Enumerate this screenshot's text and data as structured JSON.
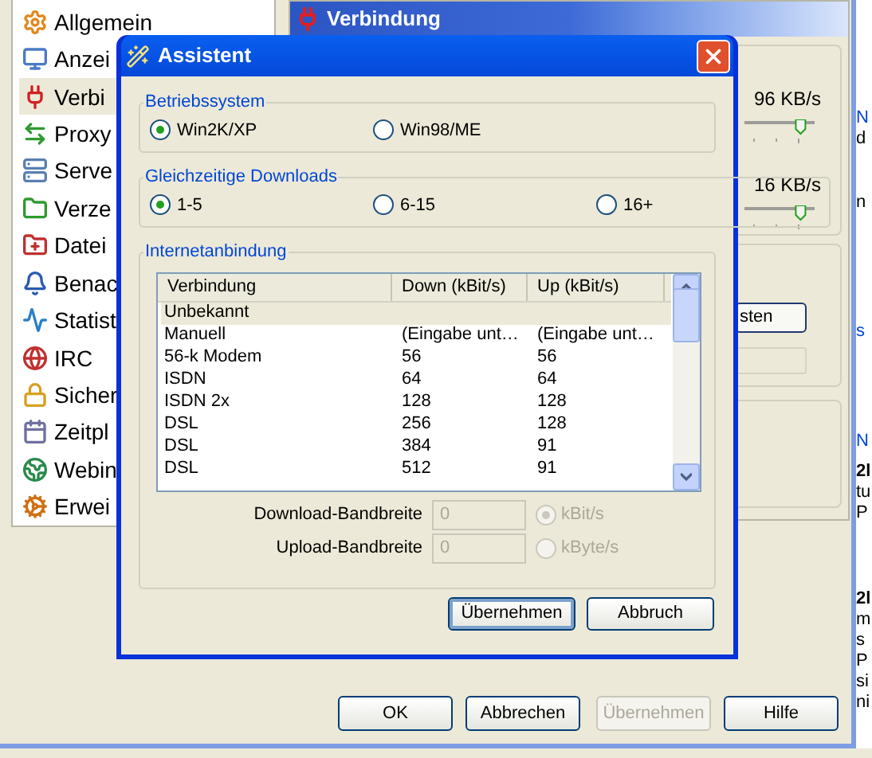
{
  "settings_window": {
    "categories": [
      {
        "label": "Allgemein",
        "selected": false
      },
      {
        "label": "Anzei",
        "selected": false
      },
      {
        "label": "Verbi",
        "selected": true
      },
      {
        "label": "Proxy",
        "selected": false
      },
      {
        "label": "Serve",
        "selected": false
      },
      {
        "label": "Verze",
        "selected": false
      },
      {
        "label": "Datei",
        "selected": false
      },
      {
        "label": "Benac",
        "selected": false
      },
      {
        "label": "Statist",
        "selected": false
      },
      {
        "label": "IRC",
        "selected": false
      },
      {
        "label": "Sicher",
        "selected": false
      },
      {
        "label": "Zeitpl",
        "selected": false
      },
      {
        "label": "Webin",
        "selected": false
      },
      {
        "label": "Erwei",
        "selected": false
      }
    ],
    "panel_title": "Verbindung",
    "speed_readings": [
      "96 KB/s",
      "16 KB/s"
    ],
    "sliders": [
      {
        "level": 0.8
      },
      {
        "level": 0.8
      }
    ],
    "partial_button": "sten",
    "buttons": [
      {
        "label": "OK",
        "disabled": false
      },
      {
        "label": "Abbrechen",
        "disabled": false
      },
      {
        "label": "Übernehmen",
        "disabled": true
      },
      {
        "label": "Hilfe",
        "disabled": false
      }
    ]
  },
  "assistant_dialog": {
    "title": "Assistent",
    "os_group": {
      "legend": "Betriebssystem",
      "options": [
        {
          "label": "Win2K/XP",
          "selected": true
        },
        {
          "label": "Win98/ME",
          "selected": false
        }
      ]
    },
    "downloads_group": {
      "legend": "Gleichzeitige Downloads",
      "options": [
        {
          "label": "1-5",
          "selected": true
        },
        {
          "label": "6-15",
          "selected": false
        },
        {
          "label": "16+",
          "selected": false
        }
      ]
    },
    "connection_group": {
      "legend": "Internetanbindung",
      "columns": [
        "Verbindung",
        "Down (kBit/s)",
        "Up (kBit/s)"
      ],
      "rows": [
        {
          "cells": [
            "Unbekannt",
            "",
            ""
          ],
          "selected": true
        },
        {
          "cells": [
            "Manuell",
            "(Eingabe unt…",
            "(Eingabe unt…"
          ],
          "selected": false
        },
        {
          "cells": [
            "56-k Modem",
            "56",
            "56"
          ],
          "selected": false
        },
        {
          "cells": [
            "ISDN",
            "64",
            "64"
          ],
          "selected": false
        },
        {
          "cells": [
            "ISDN 2x",
            "128",
            "128"
          ],
          "selected": false
        },
        {
          "cells": [
            "DSL",
            "256",
            "128"
          ],
          "selected": false
        },
        {
          "cells": [
            "DSL",
            "384",
            "91"
          ],
          "selected": false
        },
        {
          "cells": [
            "DSL",
            "512",
            "91"
          ],
          "selected": false
        }
      ],
      "bandwidth": [
        {
          "label": "Download-Bandbreite",
          "value": "0",
          "unit": "kBit/s",
          "selected": true
        },
        {
          "label": "Upload-Bandbreite",
          "value": "0",
          "unit": "kByte/s",
          "selected": false
        }
      ]
    },
    "buttons": [
      {
        "label": "Übernehmen",
        "focused": true
      },
      {
        "label": "Abbruch",
        "focused": false
      }
    ]
  },
  "side_window": {
    "top_lines": [
      {
        "text": "N",
        "kind": "link"
      },
      {
        "text": "d",
        "kind": "text"
      },
      {
        "text": "n",
        "kind": "text"
      },
      {
        "text": "s",
        "kind": "link"
      },
      {
        "text": "N",
        "kind": "link"
      }
    ],
    "paragraphs": [
      [
        "2l",
        "tu",
        "P"
      ],
      [
        "2l",
        "m",
        "s",
        "P",
        "si",
        "ni"
      ]
    ]
  }
}
